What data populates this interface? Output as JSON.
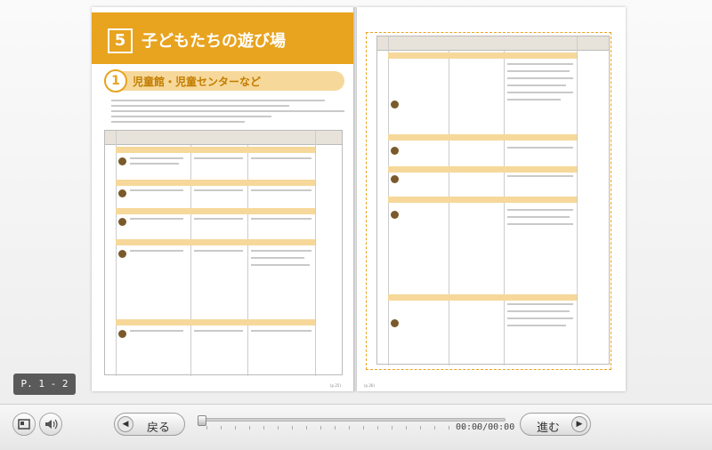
{
  "page_indicator": "P. 1 - 2",
  "left_page": {
    "chapter_number": "5",
    "chapter_title": "子どもたちの遊び場",
    "section_number": "1",
    "section_title": "児童館・児童センターなど",
    "page_no": "(p.25)"
  },
  "right_page": {
    "page_no": "(p.26)"
  },
  "toolbar": {
    "prev_label": "戻る",
    "next_label": "進む",
    "time": "00:00/00:00"
  },
  "icons": {
    "screen": "screen-icon",
    "sound": "speaker-icon",
    "prev": "triangle-left-icon",
    "next": "triangle-right-icon"
  },
  "colors": {
    "accent": "#e8a31f",
    "accent_light": "#f6d89a",
    "indicator_bg": "#5a5a5a"
  }
}
